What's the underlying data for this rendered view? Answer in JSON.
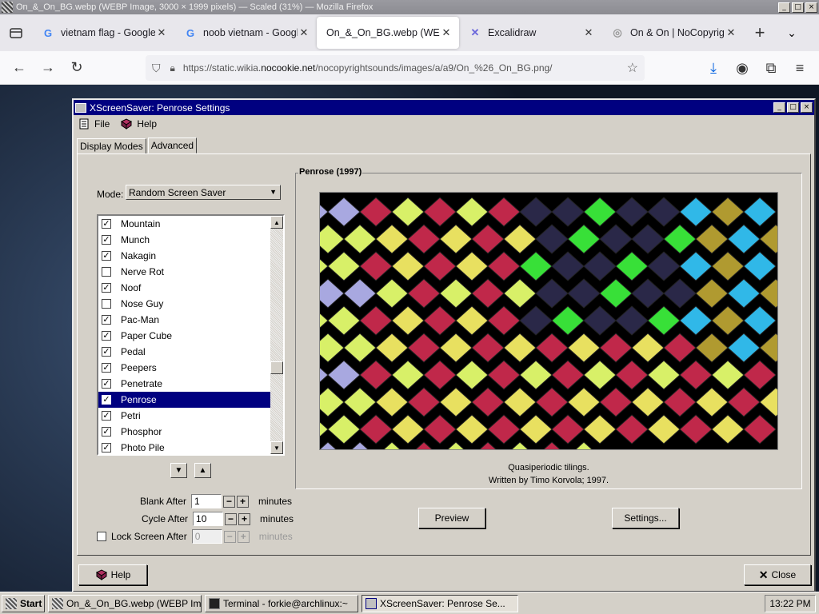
{
  "firefox": {
    "window_title": "On_&_On_BG.webp (WEBP Image, 3000 × 1999 pixels) — Scaled (31%) — Mozilla Firefox",
    "tabs": [
      {
        "label": "vietnam flag - Google Sea",
        "icon": "google-icon"
      },
      {
        "label": "noob vietnam - Google Se",
        "icon": "google-icon"
      },
      {
        "label": "On_&_On_BG.webp (WEBP I",
        "icon": "image-icon"
      },
      {
        "label": "Excalidraw",
        "icon": "excalidraw-icon"
      },
      {
        "label": "On & On | NoCopyrightSo",
        "icon": "globe-icon"
      }
    ],
    "url_prefix": "https://static.wikia.",
    "url_host": "nocookie.net",
    "url_suffix": "/nocopyrightsounds/images/a/a9/On_%26_On_BG.png/"
  },
  "xscreensaver": {
    "title": "XScreenSaver: Penrose Settings",
    "menu_file": "File",
    "menu_help": "Help",
    "tab_display_modes": "Display Modes",
    "tab_advanced": "Advanced",
    "mode_label": "Mode:",
    "mode_value": "Random Screen Saver",
    "hacks": [
      {
        "name": "Mountain",
        "checked": true
      },
      {
        "name": "Munch",
        "checked": true
      },
      {
        "name": "Nakagin",
        "checked": true
      },
      {
        "name": "Nerve Rot",
        "checked": false
      },
      {
        "name": "Noof",
        "checked": true
      },
      {
        "name": "Nose Guy",
        "checked": false
      },
      {
        "name": "Pac-Man",
        "checked": true
      },
      {
        "name": "Paper Cube",
        "checked": true
      },
      {
        "name": "Pedal",
        "checked": true
      },
      {
        "name": "Peepers",
        "checked": true
      },
      {
        "name": "Penetrate",
        "checked": true
      },
      {
        "name": "Penrose",
        "checked": true,
        "selected": true
      },
      {
        "name": "Petri",
        "checked": true
      },
      {
        "name": "Phosphor",
        "checked": true
      },
      {
        "name": "Photo Pile",
        "checked": true
      }
    ],
    "blank_after_label": "Blank After",
    "blank_after_value": "1",
    "cycle_after_label": "Cycle After",
    "cycle_after_value": "10",
    "lock_screen_label": "Lock Screen After",
    "lock_screen_value": "0",
    "minutes": "minutes",
    "frame_title": "Penrose (1997)",
    "desc_line1": "Quasiperiodic tilings.",
    "desc_line2": "Written by Timo Korvola; 1997.",
    "preview_button": "Preview",
    "settings_button": "Settings...",
    "help_button": "Help",
    "close_button": "Close"
  },
  "taskbar": {
    "start": "Start",
    "items": [
      "On_&_On_BG.webp (WEBP Ima...",
      "Terminal - forkie@archlinux:~",
      "XScreenSaver: Penrose Se..."
    ],
    "clock": "13:22 PM"
  },
  "colors": {
    "title_blue": "#000080",
    "tile_red": "#c0284a",
    "tile_yellow": "#e8e060",
    "tile_lime": "#d8f068",
    "tile_green": "#38e038",
    "tile_navy": "#2a2848"
  }
}
